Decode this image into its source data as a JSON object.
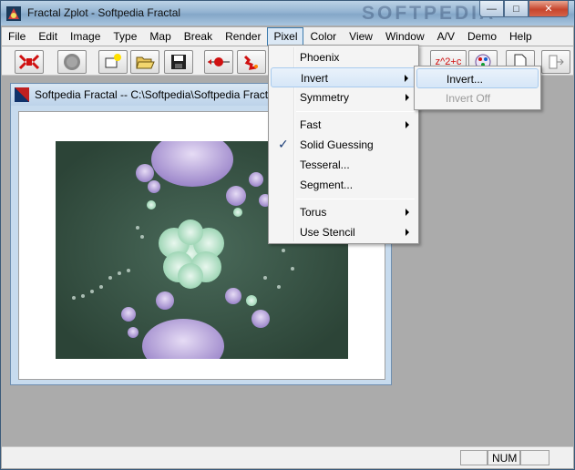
{
  "window": {
    "title": "Fractal Zplot - Softpedia Fractal",
    "watermark": "SOFTPEDIA",
    "controls": {
      "minimize": "—",
      "maximize": "□",
      "close": "✕"
    }
  },
  "menubar": {
    "items": [
      {
        "label": "File",
        "mnemonic": "F"
      },
      {
        "label": "Edit",
        "mnemonic": "E"
      },
      {
        "label": "Image",
        "mnemonic": "I"
      },
      {
        "label": "Type",
        "mnemonic": "T"
      },
      {
        "label": "Map",
        "mnemonic": "M"
      },
      {
        "label": "Break",
        "mnemonic": "B"
      },
      {
        "label": "Render",
        "mnemonic": "R"
      },
      {
        "label": "Pixel",
        "mnemonic": "P"
      },
      {
        "label": "Color",
        "mnemonic": "C"
      },
      {
        "label": "View",
        "mnemonic": "V"
      },
      {
        "label": "Window",
        "mnemonic": "W"
      },
      {
        "label": "A/V",
        "mnemonic": "A"
      },
      {
        "label": "Demo",
        "mnemonic": "D"
      },
      {
        "label": "Help",
        "mnemonic": "H"
      }
    ],
    "active": "Pixel"
  },
  "toolbar": {
    "formula_label": "z^2+c",
    "icons": [
      "zoom-arrows-icon",
      "sphere-icon",
      "new-yellow-icon",
      "open-folder-icon",
      "save-floppy-icon",
      "red-arrows-icon",
      "dragon-icon",
      "formula-icon",
      "palette-icon",
      "page-icon",
      "export-icon"
    ]
  },
  "child_window": {
    "title": "Softpedia Fractal -- C:\\Softpedia\\Softpedia Fractal"
  },
  "pixel_menu": {
    "items": [
      {
        "label": "Phoenix",
        "submenu": false,
        "checked": false
      },
      {
        "label": "Invert",
        "submenu": true,
        "checked": false,
        "highlighted": true
      },
      {
        "label": "Symmetry",
        "submenu": true,
        "checked": false
      },
      {
        "label": "Fast",
        "submenu": true,
        "checked": false
      },
      {
        "label": "Solid Guessing",
        "submenu": false,
        "checked": true
      },
      {
        "label": "Tesseral...",
        "submenu": false,
        "checked": false
      },
      {
        "label": "Segment...",
        "submenu": false,
        "checked": false
      },
      {
        "label": "Torus",
        "submenu": true,
        "checked": false
      },
      {
        "label": "Use Stencil",
        "submenu": true,
        "checked": false
      }
    ],
    "check_glyph": "✓"
  },
  "invert_submenu": {
    "items": [
      {
        "label": "Invert...",
        "disabled": false,
        "highlighted": true
      },
      {
        "label": "Invert Off",
        "disabled": true
      }
    ]
  },
  "statusbar": {
    "num": "NUM"
  },
  "colors": {
    "fractal_bg": "#30493c",
    "fractal_green": "#b7e3c9",
    "fractal_lilac": "#b39ddb",
    "menu_highlight": "#d6e6f7"
  }
}
